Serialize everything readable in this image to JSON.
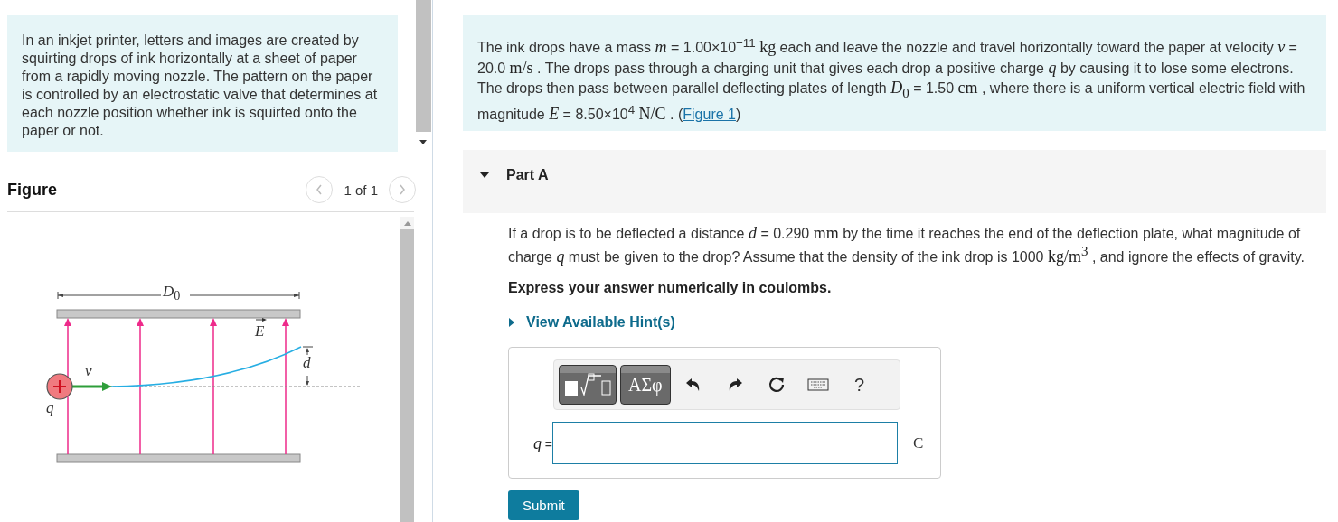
{
  "intro": {
    "text": "In an inkjet printer, letters and images are created by squirting drops of ink horizontally at a sheet of paper from a rapidly moving nozzle. The pattern on the paper is controlled by an electrostatic valve that determines at each nozzle position whether ink is squirted onto the paper or not."
  },
  "figure": {
    "title": "Figure",
    "pager": "1 of 1",
    "labels": [
      {
        "kind": "length",
        "text": "*D*$_{0}$"
      },
      {
        "kind": "field",
        "text": "*E*"
      },
      {
        "kind": "velocity",
        "text": "*v*"
      },
      {
        "kind": "deflection",
        "text": "*d*"
      },
      {
        "kind": "charge",
        "text": "*q*"
      }
    ]
  },
  "problem": {
    "segments": [
      {
        "kind": "text",
        "text": "The ink drops have a mass "
      },
      {
        "kind": "math",
        "text": "*m*"
      },
      {
        "kind": "text",
        "text": " = 1.00×10$^{−11}$ "
      },
      {
        "kind": "math",
        "text": "kg"
      },
      {
        "kind": "text",
        "text": " each and leave the nozzle and travel horizontally toward the paper at velocity "
      },
      {
        "kind": "math",
        "text": "*v*"
      },
      {
        "kind": "text",
        "text": " = 20.0 "
      },
      {
        "kind": "math",
        "text": "m/s"
      },
      {
        "kind": "text",
        "text": " . The drops pass through a charging unit that gives each drop a positive charge "
      },
      {
        "kind": "math",
        "text": "*q*"
      },
      {
        "kind": "text",
        "text": " by causing it to lose some electrons. The drops then pass between parallel deflecting plates of length "
      },
      {
        "kind": "math",
        "text": "*D*$_{0}$"
      },
      {
        "kind": "text",
        "text": " = 1.50 "
      },
      {
        "kind": "math",
        "text": "cm"
      },
      {
        "kind": "text",
        "text": " , where there is a uniform vertical electric field with magnitude "
      },
      {
        "kind": "math",
        "text": "*E*"
      },
      {
        "kind": "text",
        "text": " = 8.50×10$^{4}$ "
      },
      {
        "kind": "math",
        "text": "N/C"
      },
      {
        "kind": "text",
        "text": " . ("
      },
      {
        "kind": "link",
        "text": "Figure 1"
      },
      {
        "kind": "text",
        "text": ")"
      }
    ]
  },
  "part": {
    "title": "Part A",
    "expanded": true,
    "question": [
      {
        "kind": "text",
        "text": "If a drop is to be deflected a distance "
      },
      {
        "kind": "math",
        "text": "*d*"
      },
      {
        "kind": "text",
        "text": " = 0.290 "
      },
      {
        "kind": "math",
        "text": "mm"
      },
      {
        "kind": "text",
        "text": " by the time it reaches the end of the deflection plate, what magnitude of charge "
      },
      {
        "kind": "math",
        "text": "*q*"
      },
      {
        "kind": "text",
        "text": " must be given to the drop? Assume that the density of the ink drop is 1000 "
      },
      {
        "kind": "math",
        "text": "kg/m$^{3}$"
      },
      {
        "kind": "text",
        "text": " , and ignore the effects of gravity."
      }
    ],
    "instruction": "Express your answer numerically in coulombs.",
    "hint": {
      "label": "View Available Hint(s)",
      "expanded": false
    },
    "toolbar": [
      {
        "kind": "templates"
      },
      {
        "kind": "symbols",
        "label": "ΑΣφ"
      },
      {
        "kind": "undo"
      },
      {
        "kind": "redo"
      },
      {
        "kind": "reset"
      },
      {
        "kind": "keyboard"
      },
      {
        "kind": "help",
        "label": "?"
      }
    ],
    "answer": {
      "variable": "*q*",
      "equals": " =",
      "unit": "C"
    },
    "submit": "Submit"
  }
}
